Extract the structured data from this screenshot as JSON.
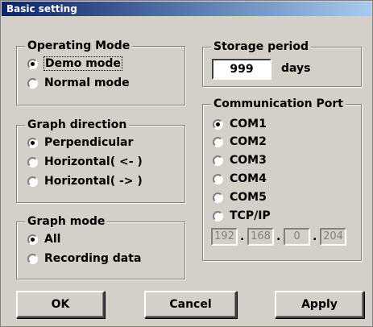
{
  "title": "Basic setting",
  "operating_mode": {
    "label": "Operating Mode",
    "options": [
      "Demo mode",
      "Normal mode"
    ],
    "selected": "Demo mode"
  },
  "graph_direction": {
    "label": "Graph direction",
    "options": [
      "Perpendicular",
      "Horizontal( <- )",
      "Horizontal( -> )"
    ],
    "selected": "Perpendicular"
  },
  "graph_mode": {
    "label": "Graph mode",
    "options": [
      "All",
      "Recording data"
    ],
    "selected": "All"
  },
  "storage_period": {
    "label": "Storage period",
    "value": "999",
    "unit": "days"
  },
  "communication_port": {
    "label": "Communication Port",
    "options": [
      "COM1",
      "COM2",
      "COM3",
      "COM4",
      "COM5",
      "TCP/IP"
    ],
    "selected": "COM1",
    "ip": [
      "192",
      "168",
      "0",
      "204"
    ]
  },
  "buttons": {
    "ok": "OK",
    "cancel": "Cancel",
    "apply": "Apply"
  }
}
